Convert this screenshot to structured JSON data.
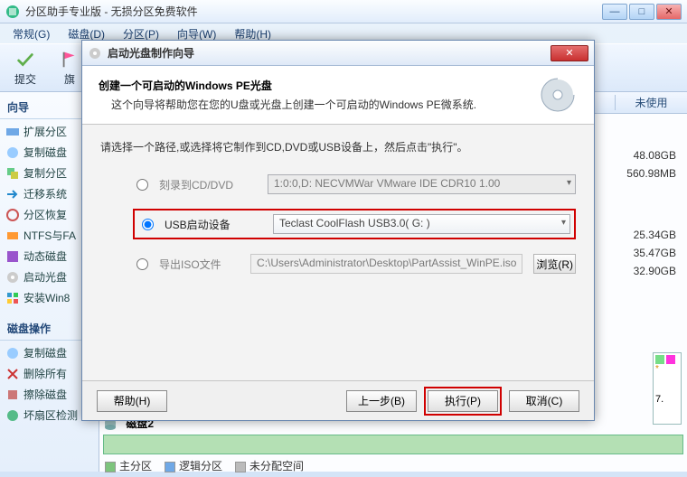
{
  "app_title": "分区助手专业版 - 无损分区免费软件",
  "menu": {
    "general": "常规(G)",
    "disk": "磁盘(D)",
    "partition": "分区(P)",
    "wizard": "向导(W)",
    "help": "帮助(H)"
  },
  "toolbar": {
    "submit": "提交",
    "other": "旗"
  },
  "left": {
    "wizard_title": "向导",
    "items1": [
      "扩展分区",
      "复制磁盘",
      "复制分区",
      "迁移系统",
      "分区恢复",
      "NTFS与FA",
      "动态磁盘",
      "启动光盘",
      "安装Win8"
    ],
    "diskops_title": "磁盘操作",
    "items2": [
      "复制磁盘",
      "删除所有",
      "擦除磁盘",
      "坏扇区检测"
    ]
  },
  "header_cols": {
    "unused": "未使用"
  },
  "right_values": [
    "48.08GB",
    "560.98MB",
    "",
    "25.34GB",
    "35.47GB",
    "32.90GB"
  ],
  "tile_right": {
    "caption": "*",
    "val": "7."
  },
  "disk2": {
    "label": "磁盘2",
    "legend_primary": "主分区",
    "legend_logical": "逻辑分区",
    "legend_unalloc": "未分配空间"
  },
  "wizard_dlg": {
    "title": "启动光盘制作向导",
    "heading": "创建一个可启动的Windows PE光盘",
    "subheading": "这个向导将帮助您在您的U盘或光盘上创建一个可启动的Windows PE微系统.",
    "instruction": "请选择一个路径,或选择将它制作到CD,DVD或USB设备上，然后点击\"执行\"。",
    "opt_burn": "刻录到CD/DVD",
    "burn_value": "1:0:0,D: NECVMWar VMware IDE CDR10 1.00",
    "opt_usb": "USB启动设备",
    "usb_value": "Teclast CoolFlash USB3.0( G: )",
    "opt_iso": "导出ISO文件",
    "iso_value": "C:\\Users\\Administrator\\Desktop\\PartAssist_WinPE.iso",
    "browse": "浏览(R)",
    "btn_help": "帮助(H)",
    "btn_back": "上一步(B)",
    "btn_exec": "执行(P)",
    "btn_cancel": "取消(C)"
  },
  "colors": {
    "accent_green": "#7dc47d",
    "accent_red": "#d00000"
  }
}
